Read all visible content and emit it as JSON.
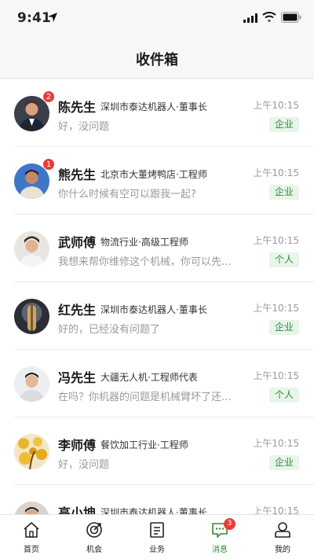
{
  "status_bar": {
    "time": "9:41"
  },
  "header": {
    "title": "收件箱"
  },
  "conversations": [
    {
      "name": "陈先生",
      "org": "深圳市泰达机器人·董事长",
      "message": "好，没问题",
      "time": "上午10:15",
      "tag": "企业",
      "unread": "2"
    },
    {
      "name": "熊先生",
      "org": "北京市大董烤鸭店·工程师",
      "message": "你什么时候有空可以跟我一起?",
      "time": "上午10:15",
      "tag": "企业",
      "unread": "1"
    },
    {
      "name": "武师傅",
      "org": "物流行业·高级工程师",
      "message": "我想来帮你维修这个机械，你可以先在线联系我",
      "time": "上午10:15",
      "tag": "个人",
      "unread": ""
    },
    {
      "name": "红先生",
      "org": "深圳市泰达机器人·董事长",
      "message": "好的，已经没有问题了",
      "time": "上午10:15",
      "tag": "企业",
      "unread": ""
    },
    {
      "name": "冯先生",
      "org": "大疆无人机·工程师代表",
      "message": "在吗？你机器的问题是机械臂坏了还是电机坏了",
      "time": "上午10:15",
      "tag": "个人",
      "unread": ""
    },
    {
      "name": "李师傅",
      "org": "餐饮加工行业·工程师",
      "message": "好，没问题",
      "time": "上午10:15",
      "tag": "企业",
      "unread": ""
    },
    {
      "name": "高小坤",
      "org": "深圳市泰达机器人·董事长",
      "message": "",
      "time": "上午10:15",
      "tag": "",
      "unread": ""
    }
  ],
  "tabbar": {
    "home": "首页",
    "opportunity": "机会",
    "business": "业务",
    "messages": "消息",
    "messages_badge": "3",
    "mine": "我的"
  },
  "colors": {
    "accent": "#2e8b3a",
    "badge": "#ea3b3b",
    "tag_bg": "#e8f5e9"
  },
  "icons": [
    "location-arrow-icon",
    "signal-icon",
    "wifi-icon",
    "battery-icon",
    "home-icon",
    "target-icon",
    "document-icon",
    "chat-icon",
    "user-icon"
  ]
}
